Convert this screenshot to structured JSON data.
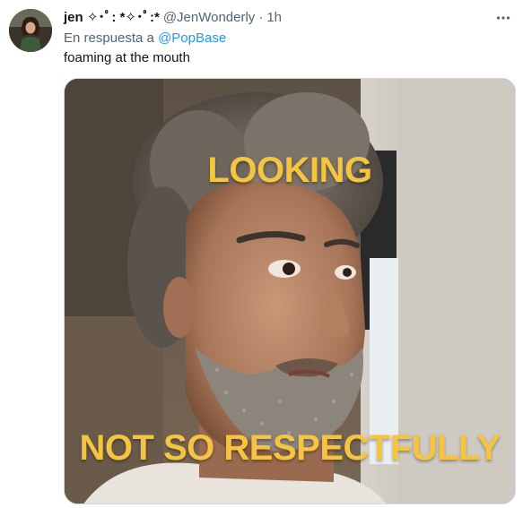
{
  "tweet": {
    "display_name": "jen ✧･ﾟ: *✧･ﾟ:*",
    "handle": "@JenWonderly",
    "separator": "·",
    "time": "1h",
    "reply_prefix": "En respuesta a",
    "reply_mention": "@PopBase",
    "text": "foaming at the mouth",
    "more_icon": "more-horizontal-icon"
  },
  "media": {
    "caption_top": "LOOKING",
    "caption_bottom": "NOT SO RESPECTFULLY",
    "caption_color": "#f5c542"
  },
  "colors": {
    "text_primary": "#0f1419",
    "text_secondary": "#536471",
    "link": "#1d9bf0",
    "border": "#cfd9de"
  }
}
